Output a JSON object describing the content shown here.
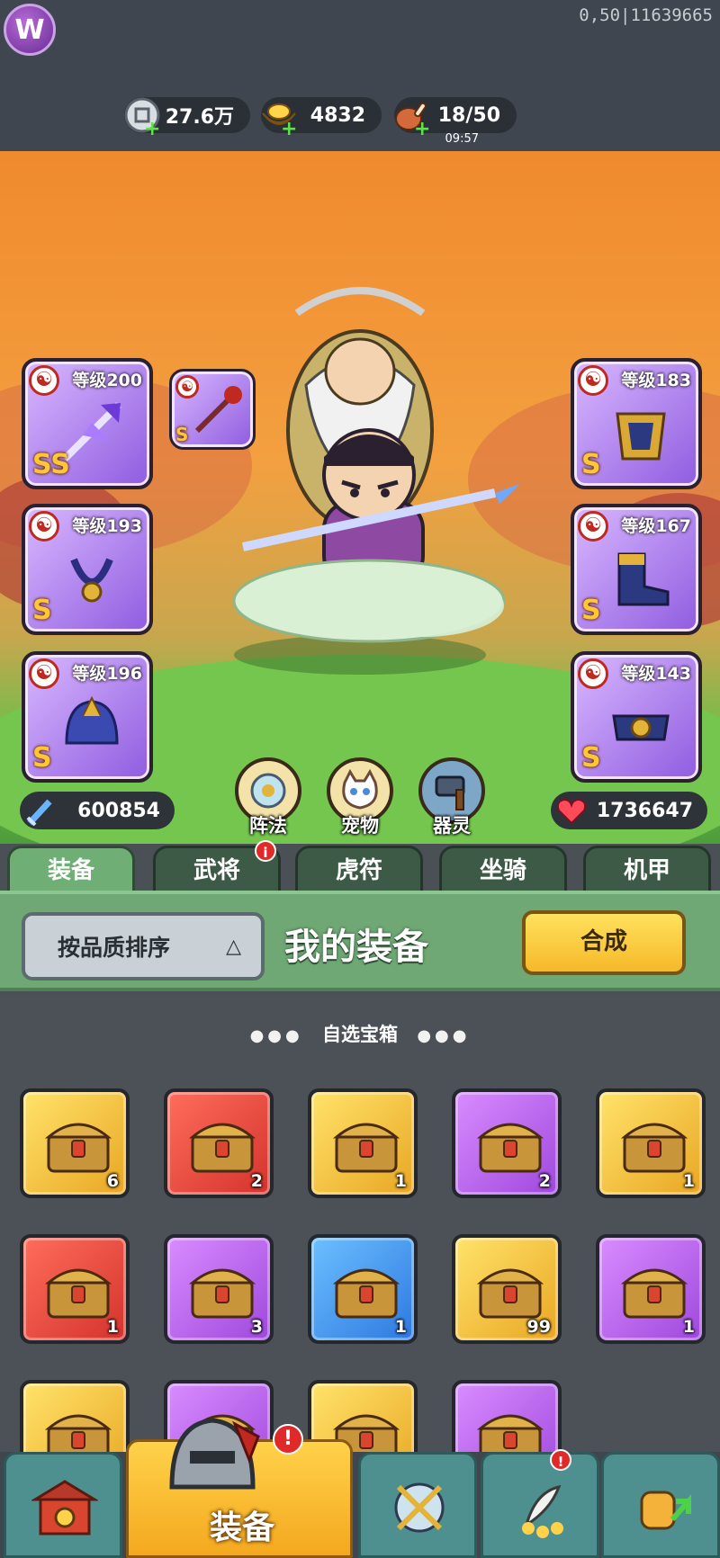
{
  "header": {
    "logo_letter": "W",
    "uid": "0,50|11639665"
  },
  "resources": {
    "silver": {
      "value": "27.6万",
      "icon": "silver-coin-icon"
    },
    "gold": {
      "value": "4832",
      "icon": "gold-ingot-icon"
    },
    "stamina": {
      "value": "18/50",
      "timer": "09:57",
      "icon": "meat-drumstick-icon"
    }
  },
  "equipment": {
    "left": [
      {
        "level": "等级200",
        "grade": "SS"
      },
      {
        "level": "等级193",
        "grade": "S"
      },
      {
        "level": "等级196",
        "grade": "S"
      }
    ],
    "right": [
      {
        "level": "等级183",
        "grade": "S"
      },
      {
        "level": "等级167",
        "grade": "S"
      },
      {
        "level": "等级143",
        "grade": "S"
      }
    ],
    "weapon_grade": "S"
  },
  "stats": {
    "attack": "600854",
    "hp": "1736647"
  },
  "features": {
    "formation": "阵法",
    "pet": "宠物",
    "spirit": "器灵"
  },
  "tabs": [
    "装备",
    "武将",
    "虎符",
    "坐骑",
    "机甲"
  ],
  "tab_badge": "i",
  "panel": {
    "sort_label": "按品质排序",
    "title": "我的装备",
    "merge_label": "合成"
  },
  "bag": {
    "section_title": "自选宝箱",
    "row1": [
      {
        "rarity": "gold",
        "count": "6"
      },
      {
        "rarity": "red",
        "count": "2"
      },
      {
        "rarity": "gold",
        "count": "1"
      },
      {
        "rarity": "purple",
        "count": "2"
      },
      {
        "rarity": "gold",
        "count": "1"
      }
    ],
    "row2": [
      {
        "rarity": "red",
        "count": "1"
      },
      {
        "rarity": "purple",
        "count": "3"
      },
      {
        "rarity": "blue",
        "count": "1"
      },
      {
        "rarity": "gold",
        "count": "99"
      },
      {
        "rarity": "purple",
        "count": "1"
      }
    ],
    "row3": [
      {
        "rarity": "gold"
      },
      {
        "rarity": "purple"
      },
      {
        "rarity": "gold"
      },
      {
        "rarity": "purple"
      }
    ]
  },
  "bottom_nav": {
    "active_label": "装备",
    "badge": "!"
  },
  "colors": {
    "panel_green": "#6fa874",
    "merge_yellow": "#f6b82a",
    "scene_orange": "#f08a2e"
  }
}
